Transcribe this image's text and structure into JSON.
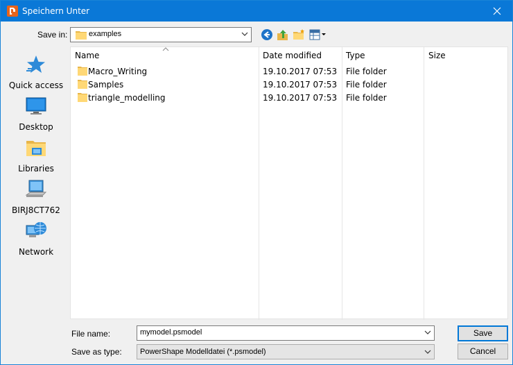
{
  "window": {
    "title": "Speichern Unter",
    "title_bar_color": "#0a78d7",
    "icons": {
      "app": "powershape-icon",
      "close": "close-icon"
    }
  },
  "toolbar": {
    "save_in_label": "Save in:",
    "save_in_value": "examples",
    "icons": [
      "back-icon",
      "up-folder-icon",
      "new-folder-icon",
      "view-menu-icon"
    ]
  },
  "places": [
    {
      "label": "Quick access",
      "icon": "star-icon"
    },
    {
      "label": "Desktop",
      "icon": "desktop-icon"
    },
    {
      "label": "Libraries",
      "icon": "libraries-icon"
    },
    {
      "label": "BIRJ8CT762",
      "icon": "computer-icon"
    },
    {
      "label": "Network",
      "icon": "network-icon"
    }
  ],
  "filelist": {
    "columns": [
      "Name",
      "Date modified",
      "Type",
      "Size"
    ],
    "rows": [
      {
        "name": "Macro_Writing",
        "date": "19.10.2017 07:53",
        "type": "File folder",
        "size": ""
      },
      {
        "name": "Samples",
        "date": "19.10.2017 07:53",
        "type": "File folder",
        "size": ""
      },
      {
        "name": "triangle_modelling",
        "date": "19.10.2017 07:53",
        "type": "File folder",
        "size": ""
      }
    ]
  },
  "bottom": {
    "file_name_label": "File name:",
    "file_name_value": "mymodel.psmodel",
    "save_type_label": "Save as type:",
    "save_type_value": "PowerShape Modelldatei (*.psmodel)",
    "save_button": "Save",
    "cancel_button": "Cancel"
  }
}
